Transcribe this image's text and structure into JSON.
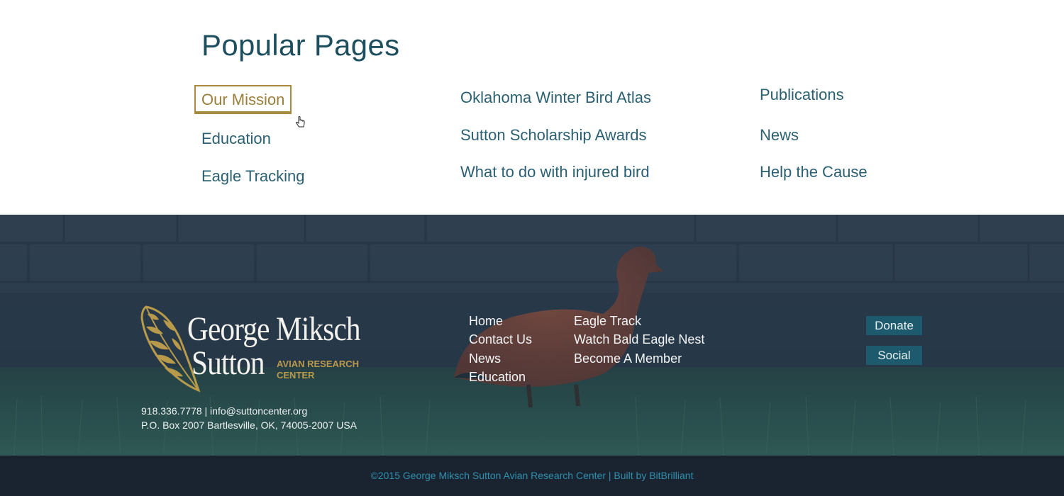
{
  "popular": {
    "title": "Popular Pages",
    "columns": [
      [
        "Our Mission",
        "Education",
        "Eagle Tracking"
      ],
      [
        "Oklahoma Winter Bird Atlas",
        "Sutton Scholarship Awards",
        "What to do with injured bird"
      ],
      [
        "Publications",
        "News",
        "Help the Cause"
      ]
    ]
  },
  "logo": {
    "line1": "George Miksch",
    "line2": "Sutton",
    "sub1": "AVIAN RESEARCH",
    "sub2": "CENTER"
  },
  "contact": {
    "line1": "918.336.7778 | info@suttoncenter.org",
    "line2": "P.O. Box 2007 Bartlesville, OK, 74005-2007 USA"
  },
  "footer_nav": {
    "col1": [
      "Home",
      "Contact Us",
      "News",
      "Education"
    ],
    "col2": [
      "Eagle Track",
      "Watch Bald Eagle Nest",
      "Become A Member"
    ]
  },
  "buttons": {
    "donate": "Donate",
    "social": "Social"
  },
  "bottom": {
    "copyright": "©2015 George Miksch Sutton Avian Research Center",
    "separator": " | ",
    "credit": "Built by BitBrilliant"
  },
  "colors": {
    "heading": "#1e4f5f",
    "link": "#2a6072",
    "active_gold": "#a8893e",
    "button_bg": "#1e5a6d",
    "bottom_bg": "#1a2430",
    "bottom_text": "#2f8fae"
  }
}
